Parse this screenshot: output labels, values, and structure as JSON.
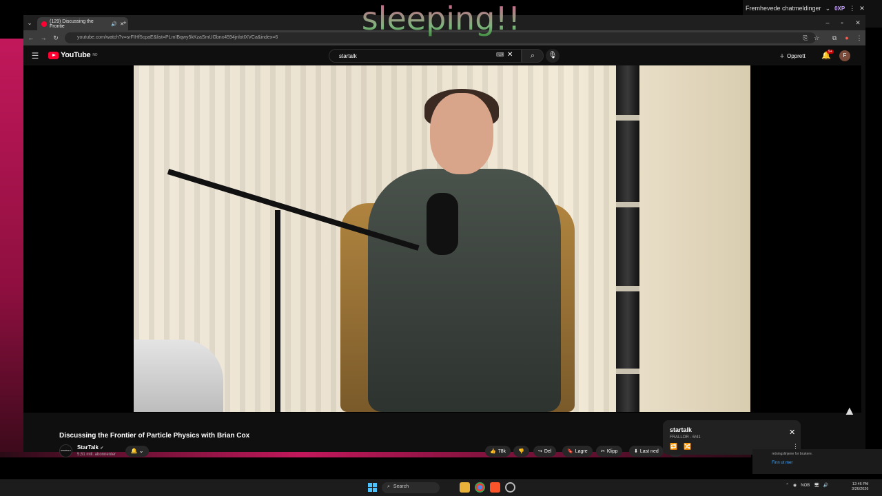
{
  "overlay": {
    "stream_label": "Fremhevede chatmeldinger",
    "oxp_label": "0XP",
    "caption": "sleeping!!"
  },
  "browser": {
    "tab_title": "(129) Discussing the Frontie",
    "url": "youtube.com/watch?v=srFIHf5cpaE&list=PLmIBqwy5kKzaSmUGbnx4594jnlotIXVCa&index=6"
  },
  "youtube": {
    "logo_text": "YouTube",
    "logo_region": "NO",
    "search_value": "startalk",
    "create_label": "Opprett",
    "notif_count": "9+",
    "avatar_letter": "F"
  },
  "video": {
    "title": "Discussing the Frontier of Particle Physics with Brian Cox",
    "channel_name": "StarTalk",
    "channel_avatar_text": "STARTALK",
    "subscribers": "5,51 mill. abonnenter",
    "actions": {
      "likes": "78k",
      "share": "Del",
      "save": "Lagre",
      "clip": "Klipp",
      "download": "Last ned"
    }
  },
  "playlist": {
    "title": "startalk",
    "subtitle": "FRALLOR - 6/41"
  },
  "notification": {
    "text": "retningslinjene for brukere.",
    "link": "Finn ut mer"
  },
  "taskbar": {
    "search_placeholder": "Search",
    "lang": "NOB",
    "time": "12:46 PM",
    "date": "3/26/2026"
  },
  "colors": {
    "youtube_red": "#ff0033",
    "accent_pink": "#c2185b",
    "windows_blue": "#4cc2ff"
  }
}
